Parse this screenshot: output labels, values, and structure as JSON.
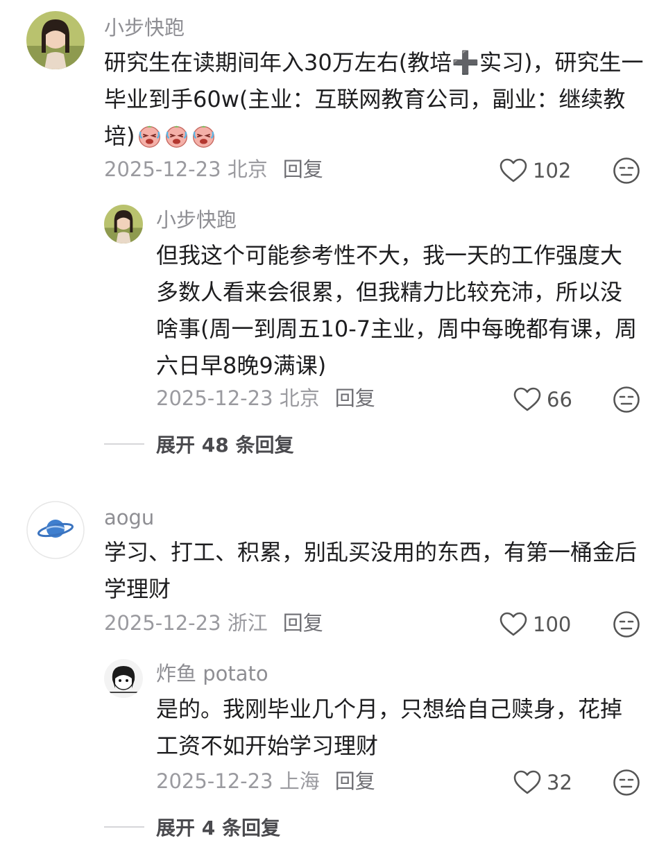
{
  "comments": [
    {
      "user": "小步快跑",
      "text": "研究生在读期间年入30万左右(教培➕实习)，研究生一毕业到手60w(主业：互联网教育公司，副业：继续教培)",
      "emoji": "laughing-crying-face",
      "date_loc": "2025-12-23 北京",
      "reply_label": "回复",
      "likes": "102",
      "replies": [
        {
          "user": "小步快跑",
          "text": "但我这个可能参考性不大，我一天的工作强度大多数人看来会很累，但我精力比较充沛，所以没啥事(周一到周五10-7主业，周中每晚都有课，周六日早8晚9满课)",
          "date_loc": "2025-12-23 北京",
          "reply_label": "回复",
          "likes": "66"
        }
      ],
      "expand_label": "展开 48 条回复"
    },
    {
      "user": "aogu",
      "text": "学习、打工、积累，别乱买没用的东西，有第一桶金后学理财",
      "date_loc": "2025-12-23 浙江",
      "reply_label": "回复",
      "likes": "100",
      "replies": [
        {
          "user": "炸鱼 potato",
          "text": "是的。我刚毕业几个月，只想给自己赎身，花掉工资不如开始学习理财",
          "date_loc": "2025-12-23 上海",
          "reply_label": "回复",
          "likes": "32"
        }
      ],
      "expand_label": "展开 4 条回复"
    }
  ],
  "icons": {
    "like": "heart-outline-icon",
    "dislike": "neutral-face-icon"
  },
  "colors": {
    "meta": "#9a9a9f",
    "text": "#1d1d1f",
    "username": "#8e8e93"
  }
}
